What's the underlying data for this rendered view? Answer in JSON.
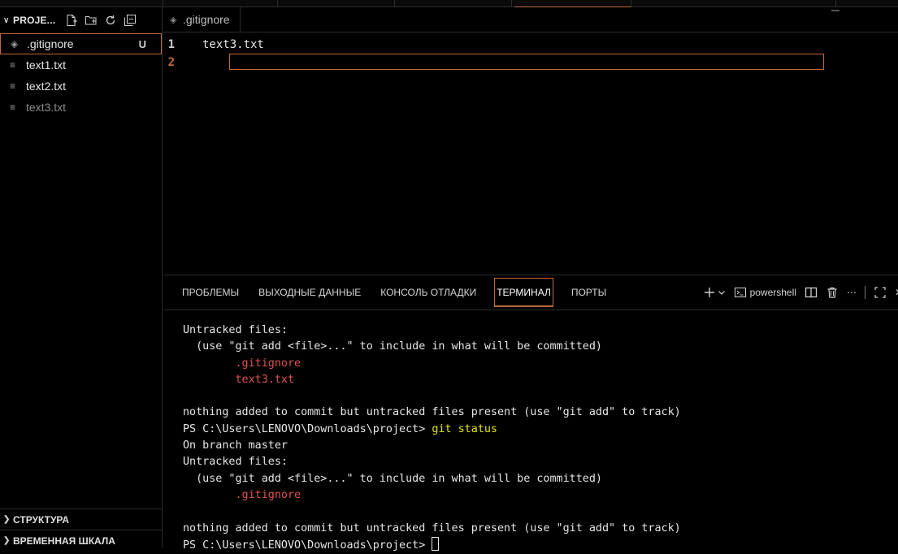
{
  "sidebar": {
    "header_title": "PROJE...",
    "files": [
      {
        "name": ".gitignore",
        "icon": "gitignore-icon",
        "badge": "U",
        "active": true
      },
      {
        "name": "text1.txt",
        "icon": "text-file-icon"
      },
      {
        "name": "text2.txt",
        "icon": "text-file-icon"
      },
      {
        "name": "text3.txt",
        "icon": "text-file-icon",
        "dim": true
      }
    ],
    "sections": [
      "СТРУКТУРА",
      "ВРЕМЕННАЯ ШКАЛА"
    ]
  },
  "editor": {
    "tab_label": ".gitignore",
    "lines": [
      {
        "number": "1",
        "text": "text3.txt"
      },
      {
        "number": "2",
        "text": ""
      }
    ]
  },
  "panel": {
    "tabs": [
      "ПРОБЛЕМЫ",
      "ВЫХОДНЫЕ ДАННЫЕ",
      "КОНСОЛЬ ОТЛАДКИ",
      "ТЕРМИНАЛ",
      "ПОРТЫ"
    ],
    "active_tab": "ТЕРМИНАЛ",
    "shell_label": "powershell"
  },
  "terminal": {
    "l1": "Untracked files:",
    "l2": "  (use \"git add <file>...\" to include in what will be committed)",
    "l3": "        .gitignore",
    "l4": "        text3.txt",
    "l6": "nothing added to commit but untracked files present (use \"git add\" to track)",
    "l7_prompt": "PS C:\\Users\\LENOVO\\Downloads\\project> ",
    "l7_cmd": "git status",
    "l8": "On branch master",
    "l9": "Untracked files:",
    "l10": "  (use \"git add <file>...\" to include in what will be committed)",
    "l11": "        .gitignore",
    "l13": "nothing added to commit but untracked files present (use \"git add\" to track)",
    "l14_prompt": "PS C:\\Users\\LENOVO\\Downloads\\project> "
  },
  "colors": {
    "accent": "#c0683c",
    "untracked": "#e05252",
    "command": "#e5e510",
    "background": "#000000"
  }
}
